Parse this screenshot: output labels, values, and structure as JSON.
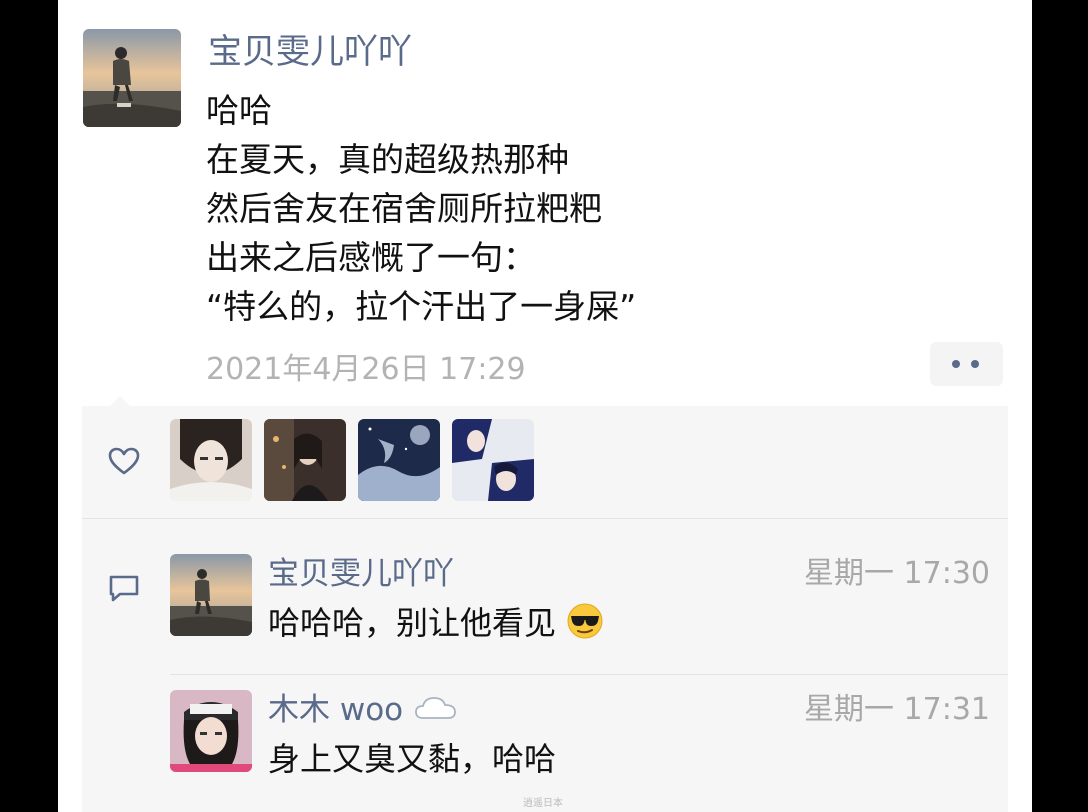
{
  "post": {
    "author_name": "宝贝雯儿吖吖",
    "lines": [
      "哈哈",
      "在夏天，真的超级热那种",
      "然后舍友在宿舍厕所拉粑粑",
      "出来之后感慨了一句：",
      "“特么的，拉个汗出了一身屎”"
    ],
    "timestamp": "2021年4月26日 17:29"
  },
  "likes": {
    "icon": "heart-outline",
    "avatar_count": 4
  },
  "comments": [
    {
      "name": "宝贝雯儿吖吖",
      "time": "星期一 17:30",
      "text": "哈哈哈，别让他看见",
      "emoji": "sunglasses-emoji"
    },
    {
      "name": "木木 woo",
      "name_icon": "cloud-icon",
      "time": "星期一 17:31",
      "text": "身上又臭又黏，哈哈"
    }
  ],
  "watermark": "逍遥日本",
  "colors": {
    "name_blue": "#5a6a8a",
    "panel_bg": "#f6f6f6",
    "timestamp_gray": "#b3b3b3"
  }
}
